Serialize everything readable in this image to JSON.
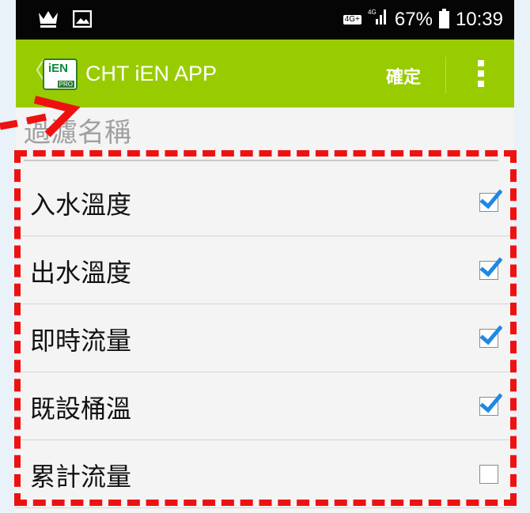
{
  "status_bar": {
    "network": "4G+",
    "signal": "4G",
    "battery": "67%",
    "time": "10:39",
    "left_icons": [
      "crown-icon",
      "image-icon"
    ]
  },
  "action_bar": {
    "title": "CHT iEN APP",
    "logo_text": "iEN",
    "logo_badge": "PRO",
    "back_glyph": "〈",
    "confirm_label": "確定"
  },
  "filter": {
    "placeholder": "過濾名稱",
    "value": ""
  },
  "items": [
    {
      "label": "入水溫度",
      "checked": true
    },
    {
      "label": "出水溫度",
      "checked": true
    },
    {
      "label": "即時流量",
      "checked": true
    },
    {
      "label": "既設桶溫",
      "checked": true
    },
    {
      "label": "累計流量",
      "checked": false
    }
  ],
  "colors": {
    "action_bar": "#99cc00",
    "checkmark": "#1e88e5",
    "annotation": "#ee1111"
  }
}
